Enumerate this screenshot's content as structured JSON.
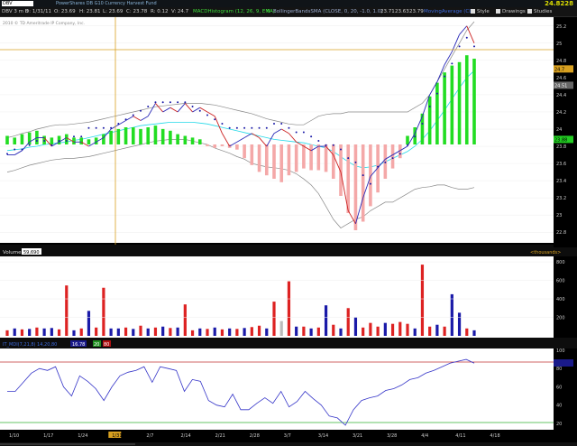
{
  "window": {
    "symbol_box": "DBV",
    "title": "PowerShares DB G10 Currency Harvest Fund",
    "last_price": "24.8228"
  },
  "toolbar": {
    "period": "DBV 3 m B",
    "date": "D: 1/31/11",
    "open": "O: 23.69",
    "high": "H: 23.81",
    "low": "L: 23.69",
    "close": "C: 23.78",
    "change": "R: 0.12",
    "volume": "V: 24.7",
    "macd_label": "MACDHistogram (12, 26, 9, EMA)",
    "macd_value": "0",
    "bb_label": "BollingerBandsSMA (CLOSE, 0, 20, -1.0, 1.0)",
    "bb_v1": "23.71",
    "bb_v2": "23.63",
    "bb_v3": "23.79",
    "moving_label": "MovingAverage (CLOSE, 20, 1.0, 5.5)",
    "style_btn": "Style",
    "drawings_btn": "Drawings",
    "studies_btn": "Studies",
    "icon_colors": {
      "check": "#dddddd",
      "accent": "#ff8800"
    }
  },
  "copyright": "2010 © TD Ameritrade IP Company, Inc.",
  "price_axis": {
    "ticks": [
      "25.2",
      "25",
      "24.8",
      "24.6",
      "24.4",
      "24.2",
      "24",
      "23.8",
      "23.6",
      "23.4",
      "23.2",
      "23",
      "22.8"
    ],
    "tags": [
      {
        "label": "24.7",
        "value": 24.7,
        "bg": "#d8a020",
        "fg": "#000000"
      },
      {
        "label": "24.51",
        "value": 24.51,
        "bg": "#666666",
        "fg": "#ffffff"
      },
      {
        "label": "23.88",
        "value": 23.88,
        "bg": "#22cc22",
        "fg": "#000000"
      }
    ]
  },
  "volume_panel": {
    "title": "Volume",
    "value": "59,690",
    "units": "<thousands>",
    "ticks": [
      "800",
      "600",
      "400",
      "200"
    ]
  },
  "osc_panel": {
    "label": "IT_MDI(7,21,8) 14,20,80",
    "value": "16.78",
    "ob": "20",
    "os": "80",
    "ticks": [
      "100",
      "80",
      "60",
      "40",
      "20"
    ]
  },
  "x_axis": {
    "labels": [
      "1/10",
      "1/17",
      "1/24",
      "1/31",
      "2/7",
      "2/14",
      "2/21",
      "2/28",
      "3/7",
      "3/14",
      "3/21",
      "3/28",
      "4/4",
      "4/11",
      "4/18"
    ],
    "highlight": "1/31"
  },
  "chart_data": {
    "type": "line",
    "price_range": [
      22.75,
      25.25
    ],
    "price": [
      23.7,
      23.7,
      23.75,
      23.85,
      23.9,
      23.9,
      23.8,
      23.85,
      23.9,
      23.85,
      23.85,
      23.8,
      23.85,
      23.9,
      24.0,
      24.05,
      24.1,
      24.15,
      24.1,
      24.15,
      24.3,
      24.2,
      24.25,
      24.2,
      24.3,
      24.2,
      24.25,
      24.2,
      24.15,
      23.95,
      23.8,
      23.85,
      23.9,
      23.95,
      23.9,
      23.8,
      23.95,
      24.0,
      23.95,
      23.85,
      23.8,
      23.75,
      23.8,
      23.8,
      23.7,
      23.5,
      23.05,
      22.9,
      23.2,
      23.45,
      23.55,
      23.65,
      23.7,
      23.75,
      23.8,
      23.95,
      24.15,
      24.4,
      24.55,
      24.75,
      24.9,
      25.1,
      25.2,
      25.0
    ],
    "psar": [
      23.65,
      23.7,
      23.7,
      23.75,
      23.8,
      23.8,
      23.75,
      23.8,
      23.8,
      23.85,
      23.85,
      23.95,
      23.95,
      23.95,
      23.95,
      24.0,
      24.05,
      24.1,
      24.15,
      24.2,
      24.25,
      24.25,
      24.25,
      24.25,
      24.25,
      24.2,
      24.15,
      24.1,
      24.05,
      24.0,
      23.95,
      23.95,
      23.95,
      23.95,
      23.95,
      23.95,
      24.0,
      24.0,
      23.95,
      23.9,
      23.9,
      23.85,
      23.8,
      23.75,
      23.75,
      23.7,
      23.6,
      23.55,
      23.4,
      23.3,
      23.5,
      23.55,
      23.6,
      23.65,
      23.75,
      23.85,
      24.0,
      24.2,
      24.35,
      24.55,
      24.7,
      24.9,
      25.0,
      24.9
    ],
    "bb_upper": [
      23.9,
      23.92,
      23.95,
      23.97,
      24.0,
      24.02,
      24.04,
      24.05,
      24.05,
      24.06,
      24.07,
      24.08,
      24.1,
      24.12,
      24.14,
      24.16,
      24.18,
      24.2,
      24.22,
      24.24,
      24.26,
      24.27,
      24.28,
      24.29,
      24.3,
      24.3,
      24.3,
      24.29,
      24.28,
      24.26,
      24.24,
      24.22,
      24.2,
      24.18,
      24.15,
      24.12,
      24.1,
      24.08,
      24.06,
      24.05,
      24.05,
      24.1,
      24.15,
      24.17,
      24.18,
      24.18,
      24.2,
      24.2,
      24.2,
      24.2,
      24.2,
      24.2,
      24.2,
      24.2,
      24.2,
      24.25,
      24.3,
      24.4,
      24.55,
      24.7,
      24.85,
      25.0,
      25.15,
      25.25
    ],
    "bb_lower": [
      23.5,
      23.52,
      23.55,
      23.58,
      23.6,
      23.62,
      23.64,
      23.65,
      23.66,
      23.66,
      23.67,
      23.68,
      23.7,
      23.72,
      23.74,
      23.76,
      23.78,
      23.8,
      23.82,
      23.84,
      23.86,
      23.87,
      23.88,
      23.88,
      23.88,
      23.86,
      23.84,
      23.82,
      23.78,
      23.75,
      23.72,
      23.68,
      23.65,
      23.6,
      23.58,
      23.56,
      23.55,
      23.54,
      23.52,
      23.48,
      23.42,
      23.35,
      23.25,
      23.1,
      22.95,
      22.85,
      22.9,
      22.95,
      22.98,
      23.05,
      23.1,
      23.15,
      23.15,
      23.2,
      23.25,
      23.3,
      23.32,
      23.33,
      23.35,
      23.35,
      23.32,
      23.3,
      23.3,
      23.32
    ],
    "ma": [
      23.75,
      23.76,
      23.77,
      23.79,
      23.8,
      23.82,
      23.83,
      23.84,
      23.85,
      23.87,
      23.88,
      23.9,
      23.92,
      23.94,
      23.96,
      23.98,
      24.0,
      24.02,
      24.04,
      24.05,
      24.06,
      24.07,
      24.08,
      24.08,
      24.08,
      24.08,
      24.07,
      24.06,
      24.04,
      24.02,
      24.0,
      23.98,
      23.96,
      23.94,
      23.92,
      23.9,
      23.88,
      23.87,
      23.86,
      23.85,
      23.84,
      23.82,
      23.8,
      23.78,
      23.74,
      23.68,
      23.62,
      23.57,
      23.55,
      23.56,
      23.58,
      23.62,
      23.66,
      23.7,
      23.74,
      23.8,
      23.88,
      23.98,
      24.1,
      24.22,
      24.35,
      24.48,
      24.6,
      24.68
    ],
    "macd": [
      0.05,
      0.04,
      0.06,
      0.07,
      0.08,
      0.05,
      0.04,
      0.05,
      0.06,
      0.04,
      0.04,
      0.03,
      0.04,
      0.06,
      0.08,
      0.09,
      0.1,
      0.1,
      0.09,
      0.1,
      0.11,
      0.09,
      0.08,
      0.06,
      0.05,
      0.04,
      0.03,
      -0.01,
      -0.02,
      -0.01,
      -0.02,
      -0.03,
      -0.08,
      -0.12,
      -0.16,
      -0.18,
      -0.2,
      -0.22,
      -0.18,
      -0.16,
      -0.14,
      -0.15,
      -0.15,
      -0.16,
      -0.2,
      -0.3,
      -0.4,
      -0.5,
      -0.45,
      -0.36,
      -0.28,
      -0.2,
      -0.14,
      -0.08,
      0.05,
      0.1,
      0.18,
      0.28,
      0.36,
      0.42,
      0.46,
      0.48,
      0.52,
      0.5
    ],
    "volume": [
      60,
      80,
      70,
      75,
      90,
      80,
      85,
      70,
      545,
      60,
      80,
      270,
      90,
      520,
      80,
      80,
      90,
      75,
      110,
      80,
      90,
      100,
      85,
      90,
      340,
      60,
      80,
      75,
      90,
      70,
      80,
      75,
      85,
      95,
      110,
      80,
      370,
      160,
      590,
      100,
      100,
      80,
      90,
      330,
      120,
      80,
      300,
      200,
      90,
      140,
      100,
      140,
      130,
      150,
      130,
      80,
      770,
      100,
      120,
      100,
      450,
      250,
      80,
      60
    ],
    "vol_color": [
      "r",
      "b",
      "r",
      "b",
      "r",
      "b",
      "b",
      "r",
      "r",
      "b",
      "r",
      "b",
      "r",
      "r",
      "b",
      "b",
      "r",
      "b",
      "r",
      "b",
      "r",
      "b",
      "r",
      "b",
      "r",
      "r",
      "b",
      "r",
      "b",
      "r",
      "b",
      "r",
      "b",
      "r",
      "r",
      "b",
      "r",
      "g",
      "r",
      "b",
      "r",
      "b",
      "r",
      "b",
      "r",
      "b",
      "r",
      "b",
      "r",
      "r",
      "r",
      "b",
      "r",
      "r",
      "r",
      "b",
      "r",
      "r",
      "b",
      "r",
      "b",
      "b",
      "r",
      "b"
    ],
    "osc": [
      55,
      55,
      65,
      75,
      80,
      78,
      82,
      60,
      50,
      72,
      66,
      58,
      45,
      60,
      72,
      76,
      78,
      82,
      65,
      82,
      80,
      78,
      55,
      68,
      66,
      45,
      40,
      38,
      52,
      35,
      35,
      42,
      48,
      42,
      55,
      38,
      44,
      55,
      47,
      40,
      28,
      26,
      18,
      35,
      45,
      48,
      50,
      56,
      58,
      62,
      68,
      70,
      75,
      78,
      82,
      86,
      88,
      90,
      86
    ],
    "osc_range": [
      15,
      100
    ],
    "vol_range": [
      0,
      820
    ]
  }
}
